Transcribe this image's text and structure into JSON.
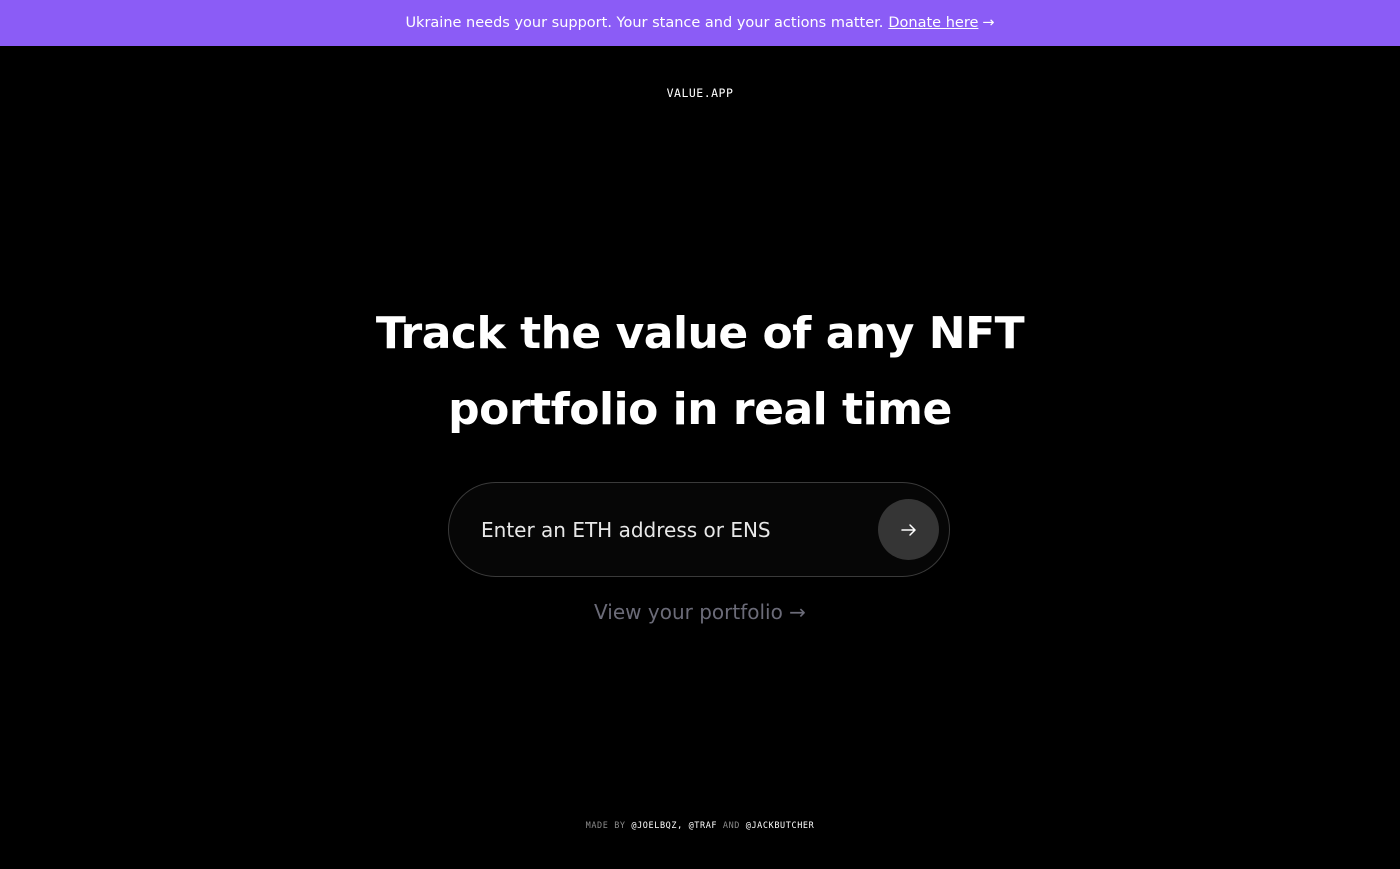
{
  "banner": {
    "message": "Ukraine needs your support. Your stance and your actions matter.",
    "link_label": "Donate here",
    "arrow": "→",
    "background": "#8b5cf6"
  },
  "header": {
    "logo": "VALUE.APP"
  },
  "hero": {
    "line1": "Track the value of any NFT",
    "line2": "portfolio in real time"
  },
  "search": {
    "placeholder": "Enter an ETH address or ENS",
    "value": "",
    "submit_icon": "arrow-right-icon"
  },
  "portfolio_link": {
    "label": "View your portfolio →"
  },
  "footer": {
    "made_by": "MADE BY",
    "handle1": "@JOELBQZ",
    "separator": ",",
    "handle2": "@TRAF",
    "and": "AND",
    "handle3": "@JACKBUTCHER"
  }
}
